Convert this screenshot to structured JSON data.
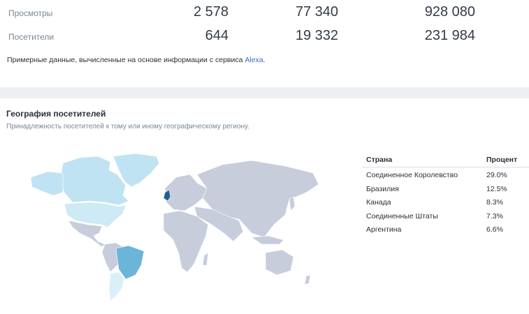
{
  "stats": {
    "views": {
      "label": "Просмотры",
      "values": [
        "2 578",
        "77 340",
        "928 080"
      ]
    },
    "visitors": {
      "label": "Посетители",
      "values": [
        "644",
        "19 332",
        "231 984"
      ]
    }
  },
  "note": {
    "text": "Примерные данные, вычисленные на основе информации с сервиса ",
    "link": "Alexa",
    "suffix": "."
  },
  "geo": {
    "title": "География посетителей",
    "subtitle": "Принадлежность посетителей к тому или иному географическому региону.",
    "table": {
      "headers": {
        "country": "Страна",
        "percent": "Процент"
      },
      "rows": [
        {
          "country": "Соединенное Королевство",
          "percent": "29.0%"
        },
        {
          "country": "Бразилия",
          "percent": "12.5%"
        },
        {
          "country": "Канада",
          "percent": "8.3%"
        },
        {
          "country": "Соединенные Штаты",
          "percent": "7.3%"
        },
        {
          "country": "Аргентина",
          "percent": "6.6%"
        }
      ]
    },
    "map_colors": {
      "base": "#c8cddc",
      "uk": "#1f5f96",
      "brazil": "#6bb5d8",
      "canada": "#bfe3f3",
      "usa": "#cdeaf6",
      "argentina": "#d9f0f9"
    }
  }
}
